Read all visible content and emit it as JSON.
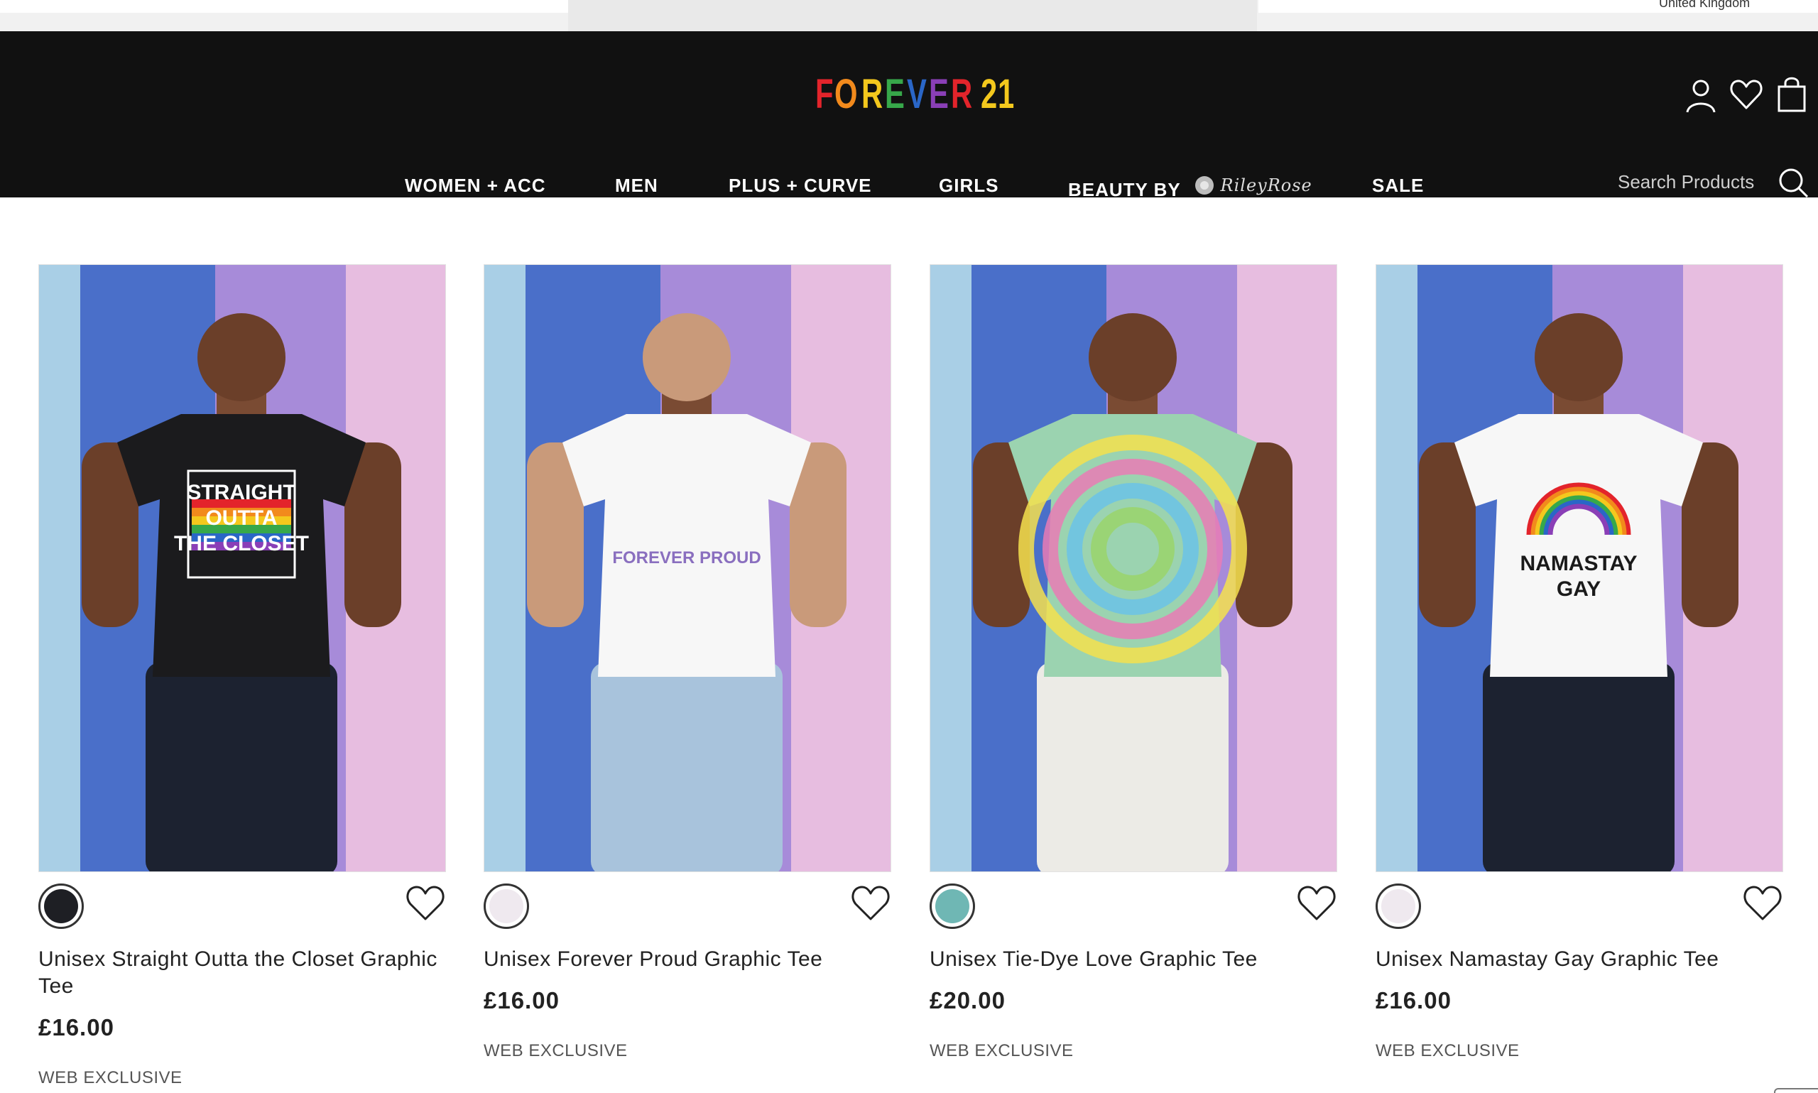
{
  "topbar": {
    "region": "United Kingdom"
  },
  "brand": {
    "letters": [
      "F",
      "O",
      "R",
      "E",
      "V",
      "E",
      "R",
      " ",
      "2",
      "1"
    ],
    "letter_colors": [
      "#e3242b",
      "#f28a1c",
      "#f4c81d",
      "#37a84a",
      "#2a66c7",
      "#8a3fb7",
      "#e3242b",
      "#111111",
      "#f4c81d",
      "#f4c81d"
    ]
  },
  "header_icons": {
    "account": "user-icon",
    "wishlist": "heart-icon",
    "bag": "shopping-bag-icon"
  },
  "nav": {
    "items": [
      "WOMEN + ACC",
      "MEN",
      "PLUS + CURVE",
      "GIRLS",
      "BEAUTY BY",
      "SALE"
    ],
    "beauty_brand": "RileyRose"
  },
  "search": {
    "placeholder": "Search Products"
  },
  "products": [
    {
      "name": "Unisex Straight Outta the Closet Graphic Tee",
      "price": "£16.00",
      "badge": "WEB EXCLUSIVE",
      "swatch_color": "#1e1f24",
      "shirt_color": "#1b1b1d",
      "shirt_text": [
        "STRAIGHT",
        "OUTTA",
        "THE CLOSET"
      ]
    },
    {
      "name": "Unisex Forever Proud Graphic Tee",
      "price": "£16.00",
      "badge": "WEB EXCLUSIVE",
      "swatch_color": "#efe9ef",
      "shirt_color": "#f7f7f7",
      "shirt_text": [
        "FOREVER PROUD"
      ]
    },
    {
      "name": "Unisex Tie-Dye Love Graphic Tee",
      "price": "£20.00",
      "badge": "WEB EXCLUSIVE",
      "swatch_color": "#6fb7b4",
      "shirt_color": "#9bd3b0",
      "shirt_text": []
    },
    {
      "name": "Unisex Namastay Gay Graphic Tee",
      "price": "£16.00",
      "badge": "WEB EXCLUSIVE",
      "swatch_color": "#efe9ef",
      "shirt_color": "#f7f7f7",
      "shirt_text": [
        "NAMASTAY",
        "GAY"
      ]
    }
  ],
  "colors": {
    "header_bg": "#111111",
    "stripes": [
      "#a9cfe6",
      "#4a6fc9",
      "#a78bd9",
      "#e7bde0"
    ]
  }
}
